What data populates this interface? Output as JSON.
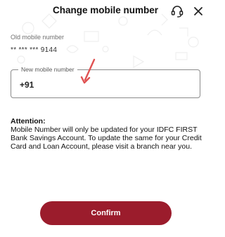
{
  "header": {
    "title": "Change mobile number",
    "support_icon": "headset-icon",
    "close_icon": "close-icon"
  },
  "old_number": {
    "label": "Old mobile number",
    "value": "** *** *** 9144"
  },
  "new_number": {
    "label": "New mobile number",
    "prefix": "+91",
    "value": "",
    "placeholder": ""
  },
  "attention": {
    "title": "Attention:",
    "body": "Mobile Number will only be updated for your IDFC FIRST Bank Savings Account. To update the same for your Credit Card and Loan Account, please visit a branch near you."
  },
  "confirm": {
    "label": "Confirm"
  },
  "colors": {
    "brand": "#9b1c2c",
    "annotation_arrow": "#e05252"
  }
}
